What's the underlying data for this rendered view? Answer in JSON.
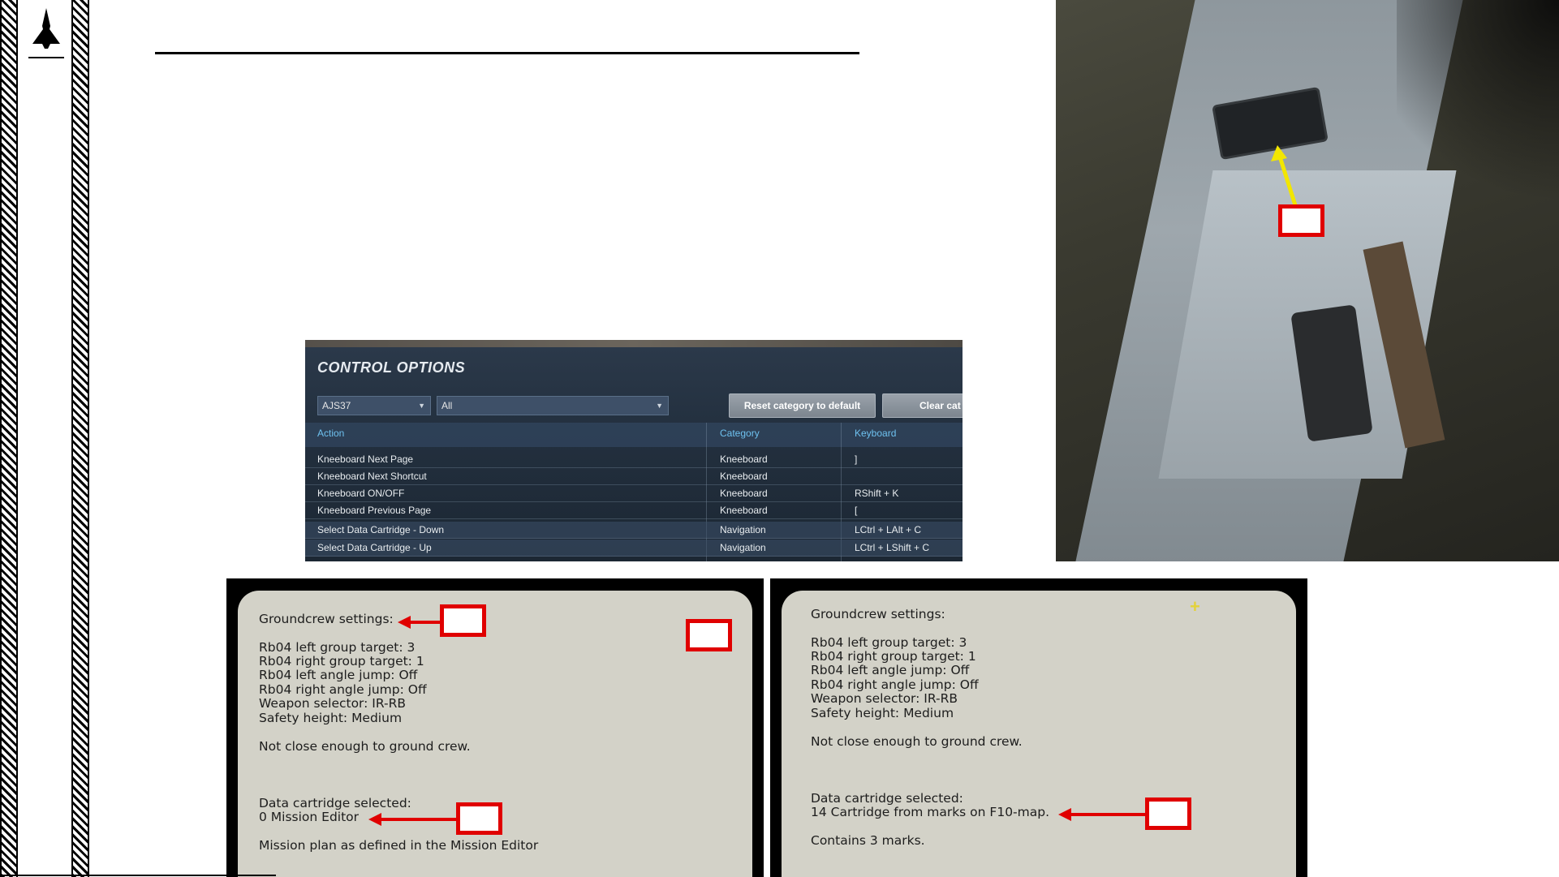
{
  "control_options": {
    "title": "CONTROL OPTIONS",
    "aircraft_select": "AJS37",
    "category_select": "All",
    "reset_button": "Reset category to default",
    "clear_button": "Clear cat",
    "columns": [
      "Action",
      "Category",
      "Keyboard"
    ],
    "rows": [
      {
        "action": "Kneeboard Next Page",
        "category": "Kneeboard",
        "keyboard": "]"
      },
      {
        "action": "Kneeboard Next Shortcut",
        "category": "Kneeboard",
        "keyboard": ""
      },
      {
        "action": "Kneeboard ON/OFF",
        "category": "Kneeboard",
        "keyboard": "RShift + K"
      },
      {
        "action": "Kneeboard Previous Page",
        "category": "Kneeboard",
        "keyboard": "["
      },
      {
        "action": "Select Data Cartridge - Down",
        "category": "Navigation",
        "keyboard": "LCtrl + LAlt + C"
      },
      {
        "action": "Select Data Cartridge - Up",
        "category": "Navigation",
        "keyboard": "LCtrl + LShift + C"
      }
    ]
  },
  "kneeboard_left": {
    "heading": "Groundcrew settings:",
    "settings": [
      "Rb04 left group target: 3",
      "Rb04 right group target: 1",
      "Rb04 left angle jump: Off",
      "Rb04 right angle jump: Off",
      "Weapon selector: IR-RB",
      "Safety height: Medium"
    ],
    "status": "Not close enough to ground crew.",
    "cartridge_label": "Data cartridge selected:",
    "cartridge_value": "0 Mission Editor",
    "note": "Mission plan as defined in the Mission Editor"
  },
  "kneeboard_right": {
    "heading": "Groundcrew settings:",
    "settings": [
      "Rb04 left group target: 3",
      "Rb04 right group target: 1",
      "Rb04 left angle jump: Off",
      "Rb04 right angle jump: Off",
      "Weapon selector: IR-RB",
      "Safety height: Medium"
    ],
    "status": "Not close enough to ground crew.",
    "cartridge_label": "Data cartridge selected:",
    "cartridge_value": "14 Cartridge from marks on F10-map.",
    "note": "Contains 3 marks."
  },
  "colors": {
    "callout_red": "#e00000",
    "arrow_yellow": "#f2e600",
    "header_cyan": "#6ec1ef",
    "kneeboard_paper": "#d3d2c8"
  },
  "icons": [
    "jet-logo-icon",
    "dropdown-caret-icon",
    "crosshair-plus-icon",
    "arrow-icon"
  ]
}
